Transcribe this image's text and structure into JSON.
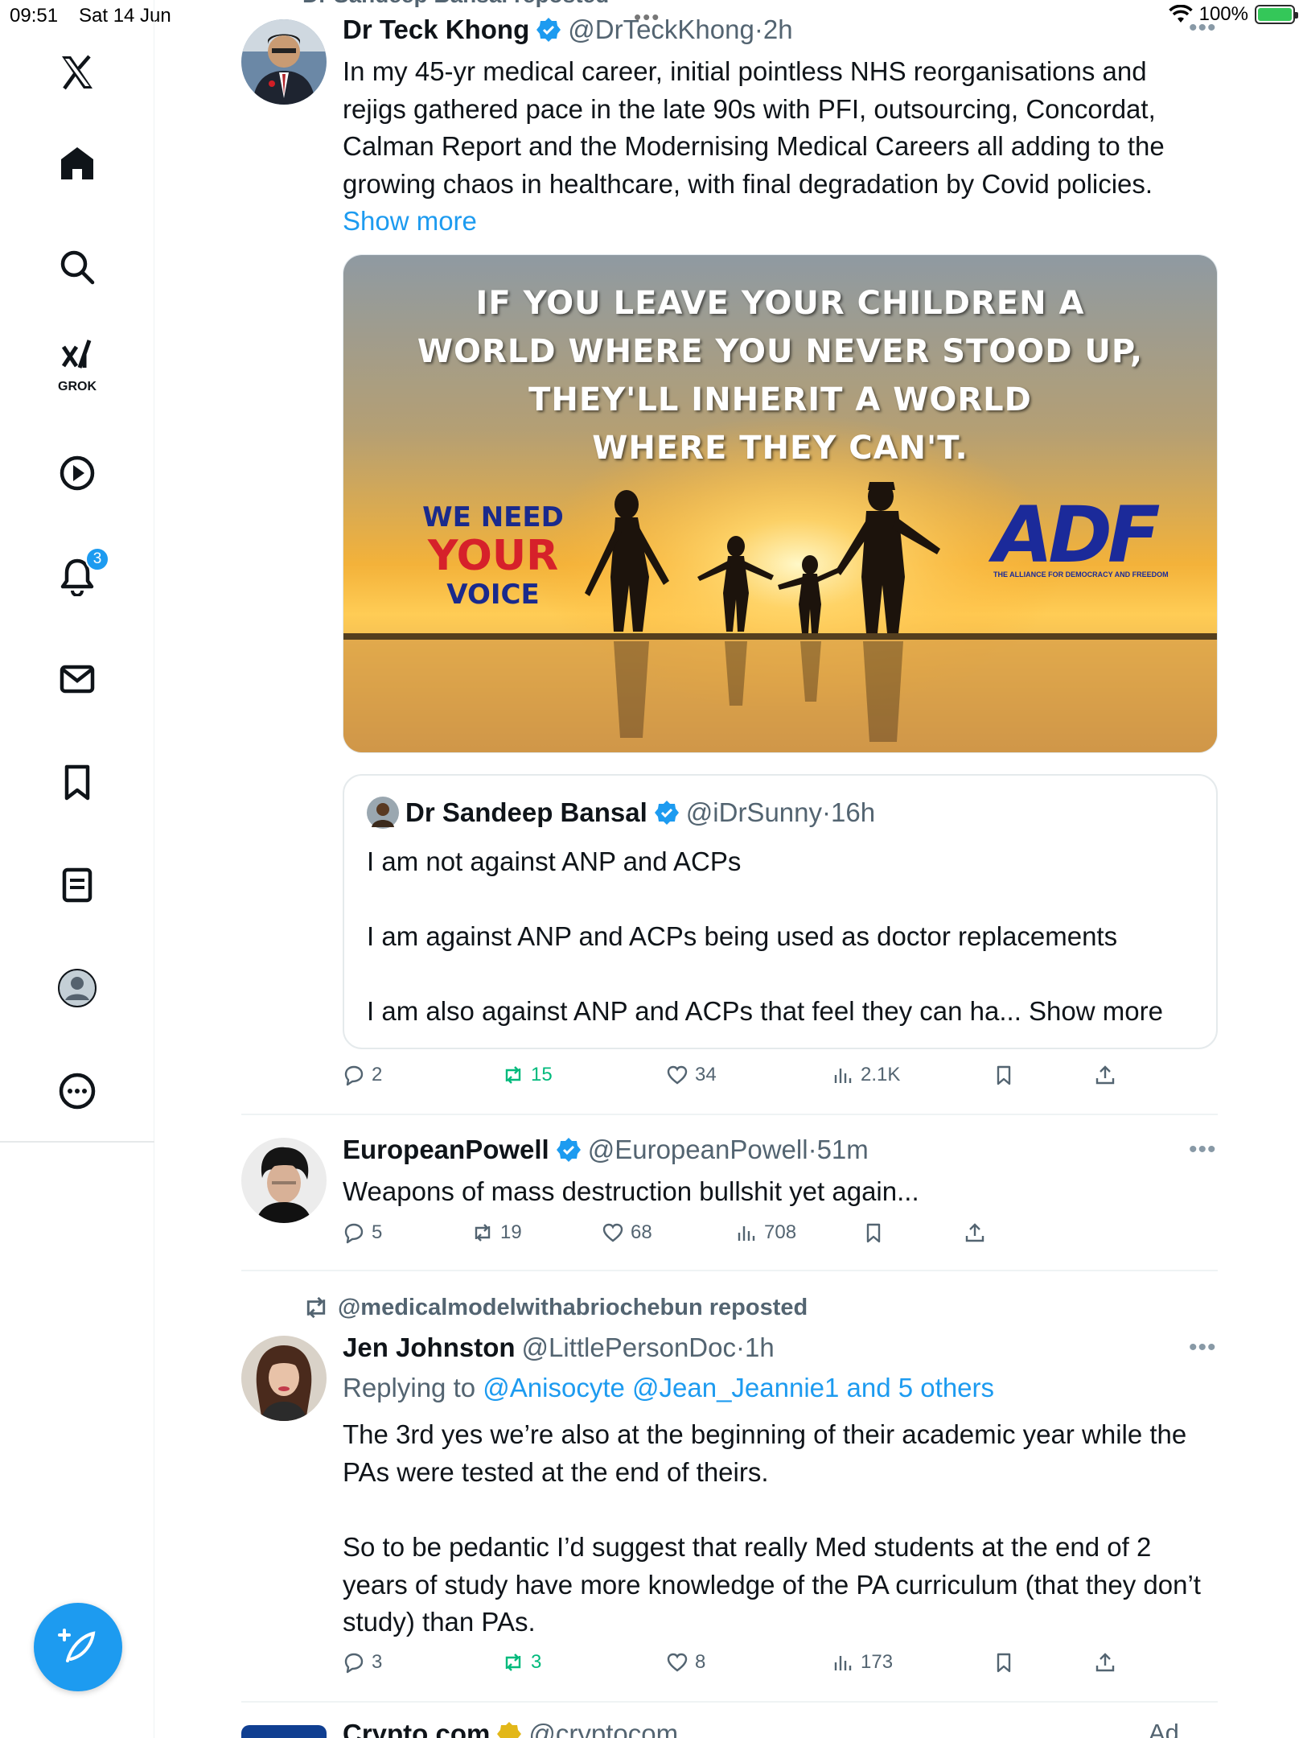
{
  "status_bar": {
    "time": "09:51",
    "date": "Sat 14 Jun",
    "dots": "•••",
    "battery": "100%"
  },
  "rail": {
    "grok_label": "GROK",
    "notifications_badge": "3"
  },
  "posts": [
    {
      "top_repost_partial": "Dr Sandeep Bansal reposted",
      "name": "Dr Teck Khong",
      "handle": "@DrTeckKhong",
      "time": "2h",
      "text": "In my 45-yr medical career, initial pointless NHS reorganisations and rejigs gathered pace in the late 90s with PFI, outsourcing, Concordat, Calman Report and the Modernising Medical Careers all adding to the growing chaos in healthcare, with final degradation by Covid policies.",
      "show_more": "Show more",
      "media": {
        "quote_lines": [
          "IF YOU LEAVE YOUR CHILDREN A",
          "WORLD WHERE YOU NEVER STOOD UP,",
          "THEY'LL INHERIT A WORLD",
          "WHERE THEY CAN'T."
        ],
        "voice_l1": "WE NEED",
        "voice_l2": "YOUR",
        "voice_l3": "VOICE",
        "logo": "ADF",
        "logo_tagline": "THE ALLIANCE FOR DEMOCRACY AND FREEDOM"
      },
      "quoted": {
        "name": "Dr Sandeep Bansal",
        "handle": "@iDrSunny",
        "time": "16h",
        "p1": "I am not against ANP and ACPs",
        "p2": "I am against ANP and ACPs being used as doctor replacements",
        "p3": "I am also against ANP and ACPs that feel they can ha... Show more"
      },
      "actions": {
        "replies": "2",
        "reposts": "15",
        "likes": "34",
        "views": "2.1K"
      }
    },
    {
      "name": "EuropeanPowell",
      "handle": "@EuropeanPowell",
      "time": "51m",
      "text": "Weapons of mass destruction bullshit yet again...",
      "actions": {
        "replies": "5",
        "reposts": "19",
        "likes": "68",
        "views": "708"
      }
    },
    {
      "repost_by": "@medicalmodelwithabriochebun reposted",
      "name": "Jen Johnston",
      "handle": "@LittlePersonDoc",
      "time": "1h",
      "replying_prefix": "Replying to",
      "replying_to": "@Anisocyte @Jean_Jeannie1 and 5 others",
      "p1": "The 3rd yes we’re also at the beginning of their academic year while the PAs were tested at the end of theirs.",
      "p2": "So to be pedantic I’d suggest that really Med students at the end of 2 years of study have more knowledge of the PA curriculum (that they don’t study) than PAs.",
      "actions": {
        "replies": "3",
        "reposts": "3",
        "likes": "8",
        "views": "173"
      }
    },
    {
      "name": "Crypto.com",
      "handle": "@cryptocom",
      "ad_label": "Ad"
    }
  ],
  "colors": {
    "accent": "#1d9bf0",
    "repost_green": "#00ba7c",
    "muted": "#536471"
  }
}
